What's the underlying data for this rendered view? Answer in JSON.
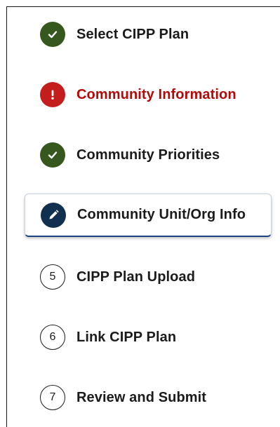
{
  "steps": [
    {
      "label": "Select CIPP Plan",
      "status": "complete",
      "icon": "check-icon"
    },
    {
      "label": "Community Information",
      "status": "error",
      "icon": "exclamation-icon"
    },
    {
      "label": "Community Priorities",
      "status": "complete",
      "icon": "check-icon"
    },
    {
      "label": "Community Unit/Org Info",
      "status": "current",
      "icon": "pencil-icon"
    },
    {
      "label": "CIPP Plan Upload",
      "status": "pending",
      "number": "5"
    },
    {
      "label": "Link CIPP Plan",
      "status": "pending",
      "number": "6"
    },
    {
      "label": "Review and Submit",
      "status": "pending",
      "number": "7"
    }
  ],
  "colors": {
    "complete": "#36571d",
    "error": "#c41d1d",
    "error_text": "#b50909",
    "current": "#112f4e",
    "active_border": "#1a4480",
    "text": "#1b1b1b"
  }
}
